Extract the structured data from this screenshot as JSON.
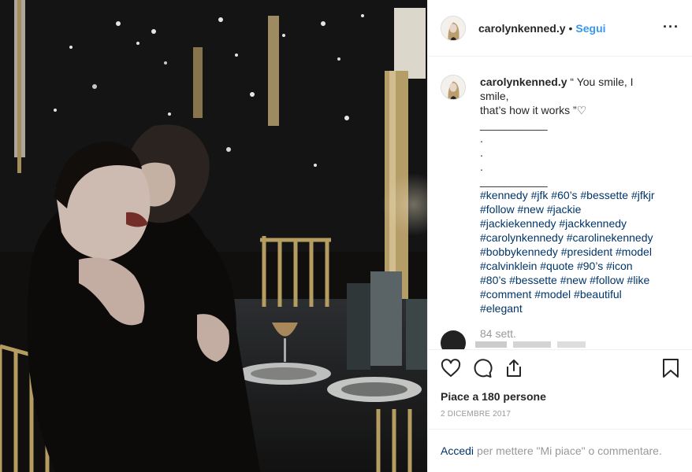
{
  "header": {
    "username": "carolynkenned.y",
    "separator": "•",
    "follow_label": "Segui",
    "more_label": "···"
  },
  "caption": {
    "username": "carolynkenned.y",
    "lines": [
      "“ You smile, I",
      "smile,",
      "that’s how it works ”♡",
      "___________",
      ".",
      ".",
      ".",
      "___________"
    ],
    "hashtags": [
      "#kennedy #jfk #60’s #bessette #jfkjr",
      "#follow #new #jackie",
      "#jackiekennedy #jackkennedy",
      "#carolynkennedy #carolinekennedy",
      "#bobbykennedy #president #model",
      "#calvinklein #quote #90’s #icon",
      "#80’s #bessette #new #follow #like",
      "#comment #model #beautiful",
      "#elegant"
    ],
    "time": "84 sett."
  },
  "actions": {
    "icons": [
      "heart-icon",
      "comment-icon",
      "share-icon",
      "bookmark-icon"
    ],
    "likes": "Piace a 180 persone",
    "date": "2 DICEMBRE 2017"
  },
  "footer": {
    "login_link": "Accedi",
    "login_text": "per mettere \"Mi piace\" o commentare."
  },
  "colors": {
    "link_blue": "#3897f0",
    "tag_blue": "#003569",
    "muted": "#999999"
  }
}
